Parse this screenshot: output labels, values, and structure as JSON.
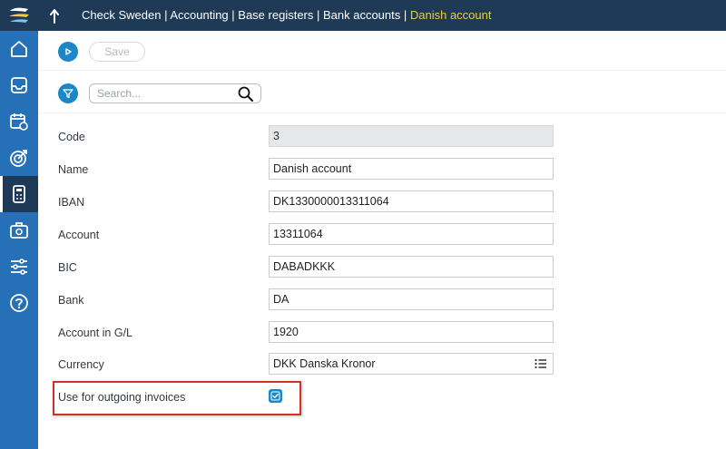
{
  "header": {
    "breadcrumb": [
      "Check Sweden",
      "Accounting",
      "Base registers",
      "Bank accounts"
    ],
    "current": "Danish account",
    "separator": " | "
  },
  "sidebar": {
    "items": [
      {
        "icon": "home-icon"
      },
      {
        "icon": "inbox-icon"
      },
      {
        "icon": "calendar-icon"
      },
      {
        "icon": "target-icon"
      },
      {
        "icon": "calculator-icon",
        "active": true
      },
      {
        "icon": "medical-case-icon"
      },
      {
        "icon": "sliders-icon"
      },
      {
        "icon": "help-icon"
      }
    ]
  },
  "toolbar": {
    "save_label": "Save",
    "search_placeholder": "Search..."
  },
  "form": {
    "fields": [
      {
        "label": "Code",
        "value": "3",
        "disabled": true
      },
      {
        "label": "Name",
        "value": "Danish account"
      },
      {
        "label": "IBAN",
        "value": "DK1330000013311064"
      },
      {
        "label": "Account",
        "value": "13311064"
      },
      {
        "label": "BIC",
        "value": "DABADKKK"
      },
      {
        "label": "Bank",
        "value": "DA"
      },
      {
        "label": "Account in G/L",
        "value": "1920"
      },
      {
        "label": "Currency",
        "value": "DKK Danska Kronor",
        "has_list": true
      }
    ],
    "checkbox": {
      "label": "Use for outgoing invoices",
      "checked": true
    }
  },
  "colors": {
    "topbar": "#1e3a56",
    "sidebar": "#2670b7",
    "accent": "#1b87c9",
    "current_crumb": "#f2c94c",
    "highlight": "#d32f2f"
  }
}
